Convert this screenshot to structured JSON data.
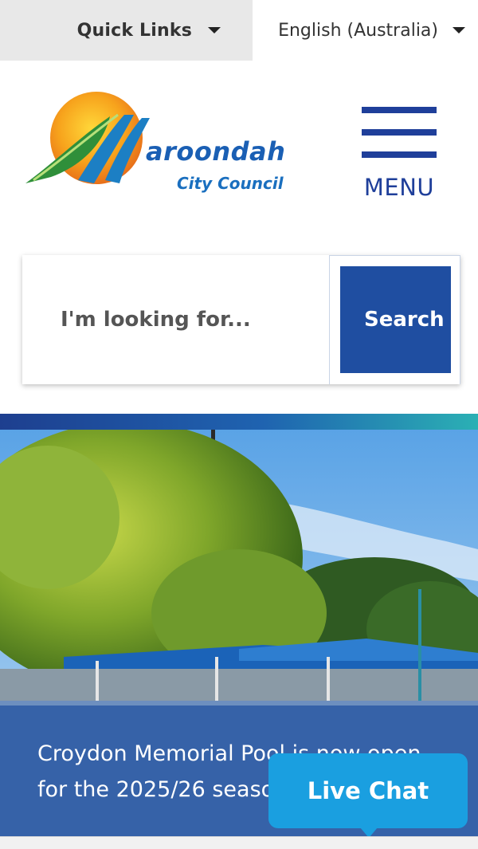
{
  "topbar": {
    "quick_links_label": "Quick Links",
    "language_label": "English (Australia)"
  },
  "logo": {
    "name": "aroondah",
    "initial": "M",
    "subtitle": "City Council"
  },
  "menu": {
    "label": "MENU"
  },
  "search": {
    "placeholder": "I'm looking for...",
    "button_label": "Search"
  },
  "hero": {
    "caption": "Croydon Memorial Pool is now open for the 2025/26 season"
  },
  "live_chat": {
    "label": "Live Chat"
  },
  "colors": {
    "brand_blue": "#1f4ea1",
    "menu_blue": "#1f3f9a",
    "chat_blue": "#1a9fe0",
    "strip_start": "#1e3f8f",
    "strip_end": "#2bb0b4"
  }
}
